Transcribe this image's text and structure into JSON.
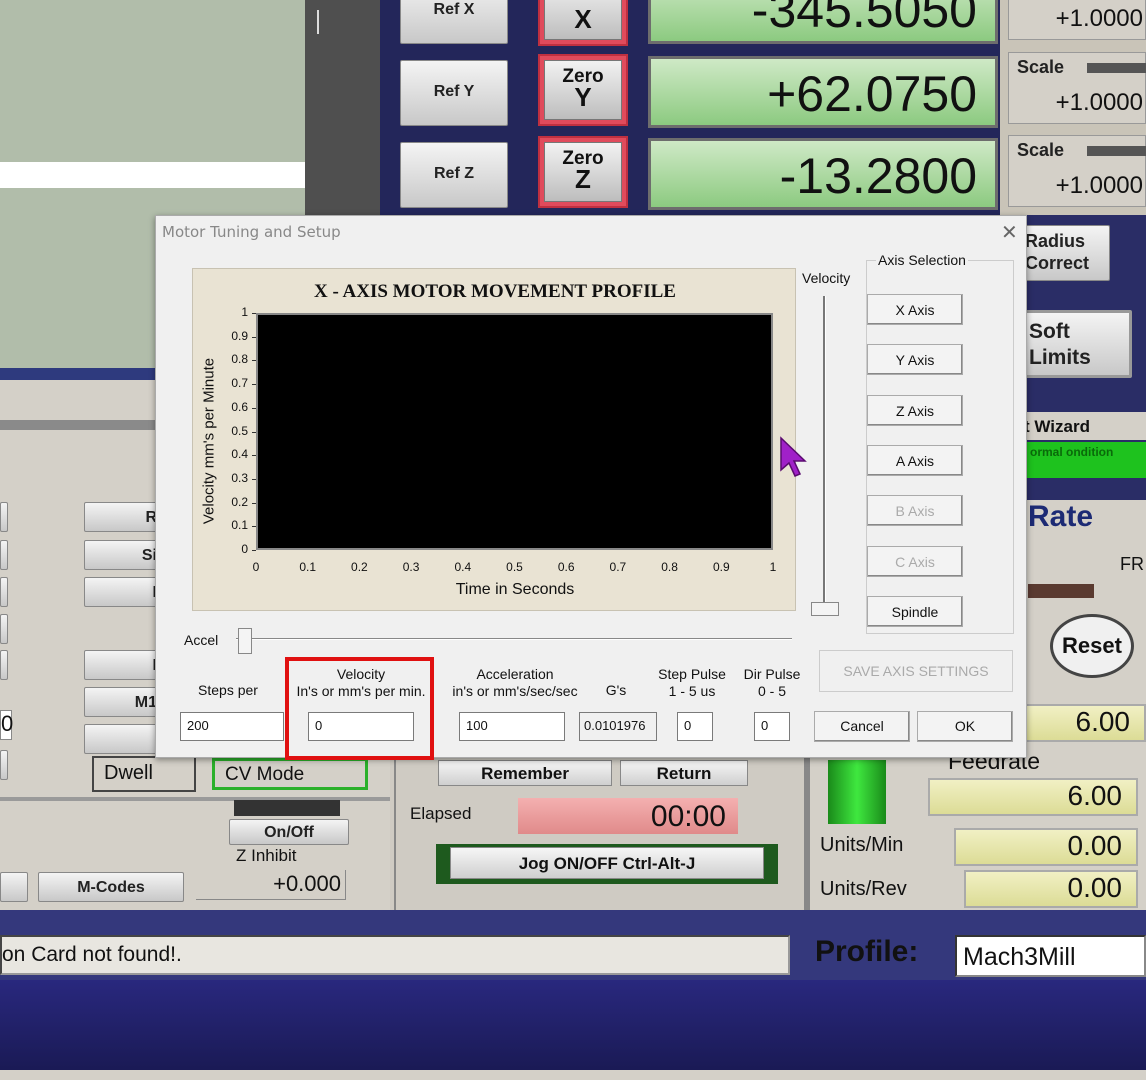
{
  "dro": {
    "x": {
      "ref_label": "Ref X",
      "zero_line1": "",
      "zero_axis": "X",
      "value": "-345.5050",
      "scale_label": "",
      "scale_value": "+1.0000"
    },
    "y": {
      "ref_label": "Ref Y",
      "zero_line1": "Zero",
      "zero_axis": "Y",
      "value": "+62.0750",
      "scale_label": "Scale",
      "scale_value": "+1.0000"
    },
    "z": {
      "ref_label": "Ref Z",
      "zero_line1": "Zero",
      "zero_axis": "Z",
      "value": "-13.2800",
      "scale_label": "Scale",
      "scale_value": "+1.0000"
    }
  },
  "right_side": {
    "radius_correct": "Radius Correct",
    "soft_limits": "Soft Limits",
    "wizard": "t Wizard",
    "normal_condition": "ormal ondition",
    "rate": "Rate",
    "fr": "FR",
    "reset": "Reset",
    "feed_value": "6.00",
    "feedrate_label": "Feedrate",
    "feedrate_value": "6.00",
    "units_min_label": "Units/Min",
    "units_min_value": "0.00",
    "units_rev_label": "Units/Rev",
    "units_rev_value": "0.00"
  },
  "left_side": {
    "btn_r": "R",
    "btn_si": "Si",
    "btn_i": "I",
    "btn_i2": "I",
    "btn_m1": "M1",
    "partial_zero": "0",
    "dwell": "Dwell",
    "cv_mode": "CV Mode",
    "on_off": "On/Off",
    "z_inhibit": "Z Inhibit",
    "m_codes": "M-Codes",
    "z_inhibit_value": "+0.000"
  },
  "middle": {
    "remember": "Remember",
    "return": "Return",
    "elapsed_label": "Elapsed",
    "elapsed_value": "00:00",
    "jog": "Jog ON/OFF Ctrl-Alt-J"
  },
  "status": {
    "message": "on Card not found!.",
    "profile_label": "Profile:",
    "profile_value": "Mach3Mill"
  },
  "dialog": {
    "title": "Motor Tuning and Setup",
    "close": "✕",
    "velocity_slider_label": "Velocity",
    "accel_slider_label": "Accel",
    "axis_group_label": "Axis Selection",
    "axis_buttons": [
      "X Axis",
      "Y Axis",
      "Z Axis",
      "A Axis",
      "B Axis",
      "C Axis",
      "Spindle"
    ],
    "save_button": "SAVE AXIS SETTINGS",
    "cancel_button": "Cancel",
    "ok_button": "OK",
    "fields": {
      "steps_label": "Steps per",
      "steps_value": "200",
      "velocity_label1": "Velocity",
      "velocity_label2": "In's or mm's per min.",
      "velocity_value": "0",
      "accel_label1": "Acceleration",
      "accel_label2": "in's or mm's/sec/sec",
      "accel_value": "100",
      "gs_label": "G's",
      "gs_value": "0.0101976",
      "step_pulse_label1": "Step Pulse",
      "step_pulse_label2": "1 - 5 us",
      "step_pulse_value": "0",
      "dir_pulse_label1": "Dir Pulse",
      "dir_pulse_label2": "0 - 5",
      "dir_pulse_value": "0"
    }
  },
  "chart_data": {
    "type": "line",
    "title": "X - AXIS MOTOR MOVEMENT PROFILE",
    "xlabel": "Time in Seconds",
    "ylabel": "Velocity mm's per Minute",
    "xlim": [
      0,
      1
    ],
    "ylim": [
      0,
      1
    ],
    "x_ticks": [
      "0",
      "0.1",
      "0.2",
      "0.3",
      "0.4",
      "0.5",
      "0.6",
      "0.7",
      "0.8",
      "0.9",
      "1"
    ],
    "y_ticks": [
      "0",
      "0.1",
      "0.2",
      "0.3",
      "0.4",
      "0.5",
      "0.6",
      "0.7",
      "0.8",
      "0.9",
      "1"
    ],
    "series": [],
    "background": "#000000"
  }
}
